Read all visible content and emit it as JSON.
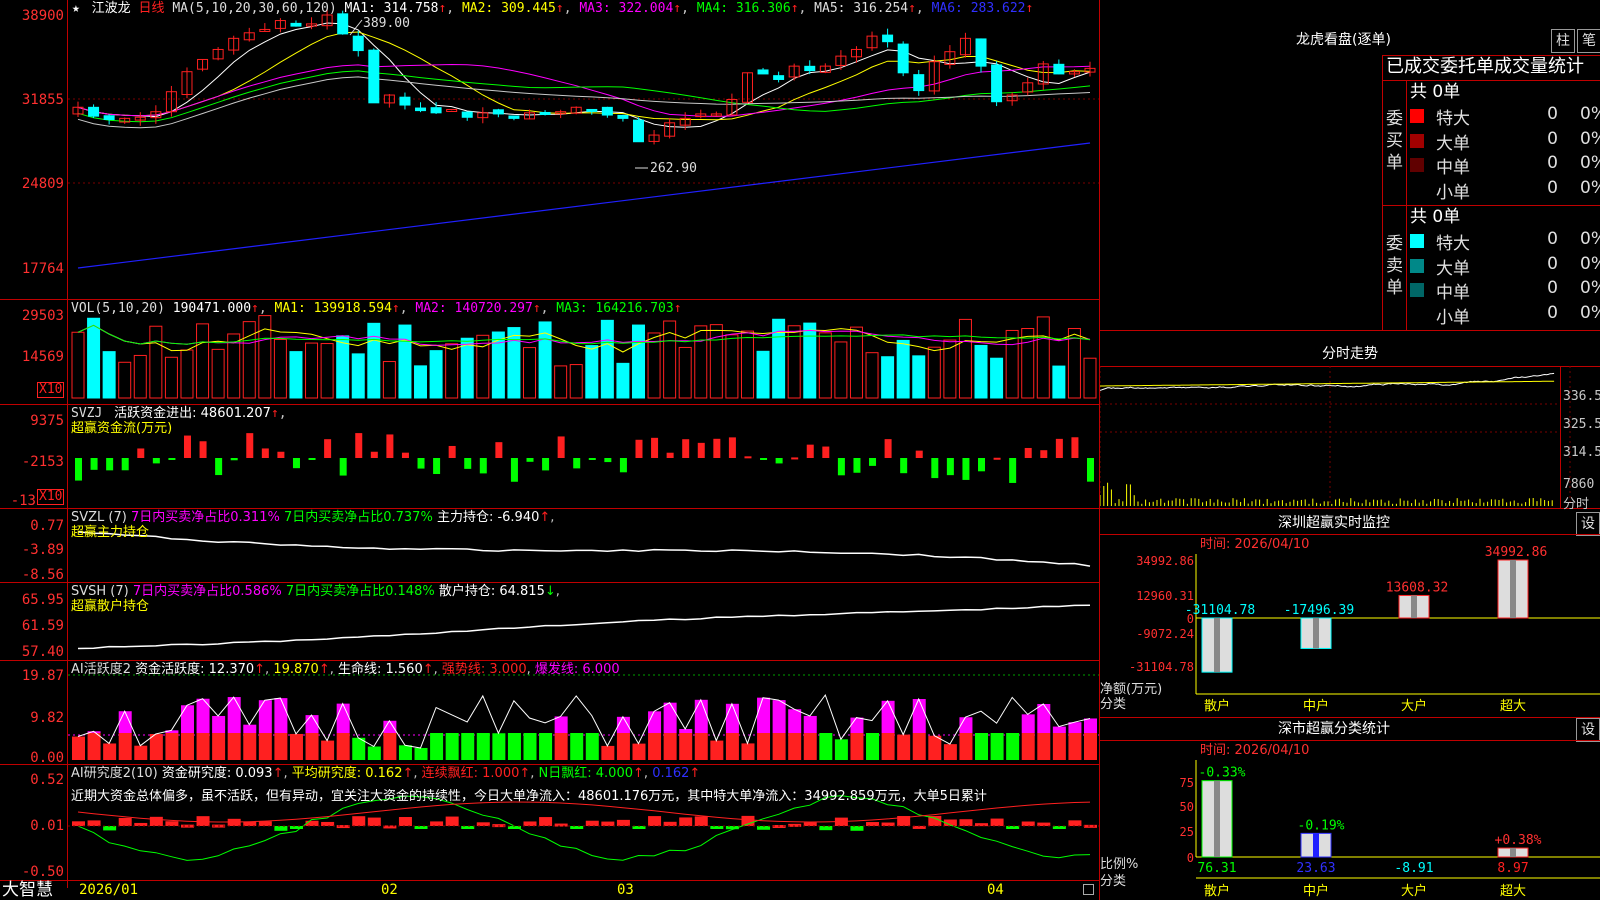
{
  "stock": {
    "star": "★",
    "name": "江波龙",
    "period": "日线"
  },
  "colors": {
    "up": "#ff2020",
    "down": "#00ffff",
    "green": "#00ff00",
    "magenta": "#ff00ff",
    "border": "#c00000",
    "yellow": "#ffff00"
  },
  "main": {
    "ma_label": "MA(5,10,20,30,60,120)",
    "ma1": "MA1: 314.758",
    "ma2": "MA2: 309.445",
    "ma3": "MA3: 322.004",
    "ma4": "MA4: 316.306",
    "ma5": "MA5: 316.254",
    "ma6": "MA6: 283.622",
    "arrow": "↑",
    "high_label": "389.00",
    "low_label": "262.90",
    "y_ticks": [
      "38900",
      "31855",
      "24809",
      "17764"
    ]
  },
  "vol": {
    "label": "VOL(5,10,20)",
    "value": "190471.000",
    "ma1": "MA1: 139918.594",
    "ma2": "MA2: 140720.297",
    "ma3": "MA3: 164216.703",
    "y_ticks": [
      "29503",
      "14569"
    ],
    "unit": "X10"
  },
  "svzj": {
    "label": "SVZJ",
    "desc": "活跃资金进出: 48601.207",
    "sub": "超赢资金流(万元)",
    "y_ticks": [
      "9375",
      "-2153",
      "-13"
    ],
    "unit": "X10"
  },
  "svzl": {
    "label": "SVZL (7)",
    "t1": "7日内买卖净占比0.311%",
    "t2": "7日内买卖净占比0.737%",
    "t3": "主力持仓: -6.940",
    "sub": "超赢主力持仓",
    "y_ticks": [
      "0.77",
      "-3.89",
      "-8.56"
    ]
  },
  "svsh": {
    "label": "SVSH (7)",
    "t1": "7日内买卖净占比0.586%",
    "t2": "7日内买卖净占比0.148%",
    "t3": "散户持仓: 64.815",
    "sub": "超赢散户持仓",
    "y_ticks": [
      "65.95",
      "61.59",
      "57.40"
    ]
  },
  "ai1": {
    "label": "AI活跃度2",
    "t1": "资金活跃度: 12.370",
    "t2": "19.870",
    "t3": "生命线: 1.560",
    "t4": "强势线: 3.000",
    "t5": "爆发线: 6.000",
    "y_ticks": [
      "19.87",
      "9.82",
      "0.00"
    ]
  },
  "ai2": {
    "label": "AI研究度2(10)",
    "t1": "资金研究度: 0.093",
    "t2": "平均研究度: 0.162",
    "t3": "连续飘红: 1.000",
    "t4": "N日飘红: 4.000",
    "t5": "0.162",
    "comment": "近期大资金总体偏多，虽不活跃，但有异动，宜关注大资金的持续性，今日大单净流入：48601.176万元，其中特大单净流入：34992.859万元，大单5日累计",
    "y_ticks": [
      "0.52",
      "0.01",
      "-0.50"
    ]
  },
  "bottom": {
    "brand": "大智慧",
    "dates": [
      "2026/01",
      "02",
      "03",
      "04"
    ]
  },
  "right": {
    "title": "龙虎看盘(逐单)",
    "btn1": "柱",
    "btn2": "笔",
    "stats_title": "已成交委托单成交量统计",
    "buy_label": "委买单",
    "sell_label": "委卖单",
    "buy_total": "共 0单",
    "sell_total": "共 0单",
    "buy_rows": [
      {
        "name": "特大",
        "count": "0",
        "pct": "0%",
        "color": "#ff0000"
      },
      {
        "name": "大单",
        "count": "0",
        "pct": "0%",
        "color": "#a00000"
      },
      {
        "name": "中单",
        "count": "0",
        "pct": "0%",
        "color": "#600000"
      },
      {
        "name": "小单",
        "count": "0",
        "pct": "0%",
        "color": "#000000"
      }
    ],
    "sell_rows": [
      {
        "name": "特大",
        "count": "0",
        "pct": "0%",
        "color": "#00ffff"
      },
      {
        "name": "大单",
        "count": "0",
        "pct": "0%",
        "color": "#008888"
      },
      {
        "name": "中单",
        "count": "0",
        "pct": "0%",
        "color": "#006666"
      },
      {
        "name": "小单",
        "count": "0",
        "pct": "0%",
        "color": "#000000"
      }
    ],
    "intraday_title": "分时走势",
    "intraday_ticks": [
      "336.5",
      "325.5",
      "314.5",
      "7860",
      "分时"
    ],
    "sz_title": "深圳超赢实时监控",
    "sz_set": "设",
    "sz_time": "时间: 2026/04/10",
    "sz_yticks": [
      "34992.86",
      "12960.31",
      "0",
      "-9072.24",
      "-31104.78"
    ],
    "sz_ylabel": "净额(万元)",
    "sz_xlabel": "分类",
    "sz_cats": [
      "散户",
      "中户",
      "大户",
      "超大"
    ],
    "sz_values": [
      -31104.78,
      -17496.39,
      13608.32,
      34992.86
    ],
    "sz_value_labels": [
      "-31104.78",
      "-17496.39",
      "13608.32",
      "34992.86"
    ],
    "sc_title": "深市超赢分类统计",
    "sc_set": "设",
    "sc_time": "时间: 2026/04/10",
    "sc_yticks": [
      "75",
      "50",
      "25",
      "0"
    ],
    "sc_ylabel": "比例%",
    "sc_xlabel": "分类",
    "sc_cats": [
      "散户",
      "中户",
      "大户",
      "超大"
    ],
    "sc_top_labels": [
      "-0.33%",
      "-0.19%",
      "",
      "+0.38%"
    ],
    "sc_values": [
      76.31,
      23.63,
      -8.91,
      8.97
    ],
    "sc_value_labels": [
      "76.31",
      "23.63",
      "-8.91",
      "8.97"
    ]
  },
  "chart_data": [
    {
      "type": "candlestick",
      "title": "江波龙 日线",
      "ylim": [
        17764,
        38900
      ],
      "x": [
        "2026/01",
        "02",
        "03",
        "04"
      ],
      "close": [
        306,
        298,
        295,
        296,
        297,
        302,
        320,
        338,
        349,
        358,
        368,
        373,
        376,
        384,
        379,
        381,
        389,
        372,
        357,
        310,
        317,
        308,
        303,
        301,
        304,
        297,
        301,
        300,
        296,
        301,
        300,
        302,
        306,
        303,
        299,
        296,
        275,
        281,
        292,
        296,
        300,
        300,
        313,
        337,
        336,
        331,
        343,
        339,
        343,
        352,
        358,
        370,
        365,
        337,
        321,
        347,
        356,
        368,
        343,
        311,
        317,
        328,
        345,
        336,
        338,
        341
      ],
      "ma_labels": [
        "MA1",
        "MA2",
        "MA3",
        "MA4",
        "MA5",
        "MA6"
      ]
    },
    {
      "type": "bar",
      "title": "SZ 超赢实时监控",
      "categories": [
        "散户",
        "中户",
        "大户",
        "超大"
      ],
      "values": [
        -31104.78,
        -17496.39,
        13608.32,
        34992.86
      ],
      "ylabel": "净额(万元)"
    },
    {
      "type": "bar",
      "title": "深市超赢分类统计",
      "categories": [
        "散户",
        "中户",
        "大户",
        "超大"
      ],
      "values": [
        76.31,
        23.63,
        -8.91,
        8.97
      ],
      "ylabel": "比例%"
    }
  ]
}
